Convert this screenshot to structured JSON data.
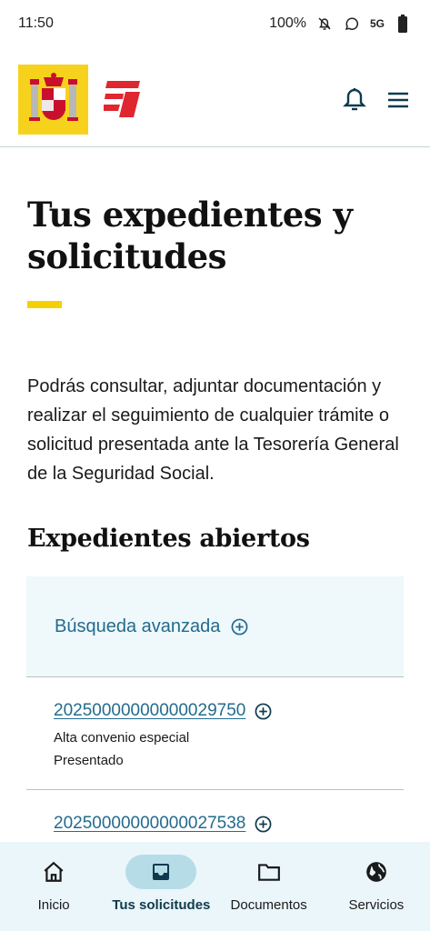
{
  "status_bar": {
    "time": "11:50",
    "battery": "100%",
    "network": "5G"
  },
  "header": {
    "notifications_icon": "bell-icon",
    "menu_icon": "hamburger-menu-icon"
  },
  "main": {
    "title": "Tus expedientes y solicitudes",
    "intro": "Podrás consultar, adjuntar documentación y realizar el seguimiento de cualquier trámite o solicitud presentada ante la Tesorería General de la Seguridad Social.",
    "section_title": "Expedientes abiertos",
    "advanced_search_label": "Búsqueda avanzada",
    "expedientes": [
      {
        "id": "20250000000000029750",
        "type": "Alta convenio especial",
        "status": "Presentado"
      },
      {
        "id": "20250000000000027538"
      }
    ]
  },
  "bottom_nav": {
    "items": [
      {
        "label": "Inicio",
        "icon": "home-icon"
      },
      {
        "label": "Tus solicitudes",
        "icon": "inbox-icon",
        "active": true
      },
      {
        "label": "Documentos",
        "icon": "folder-icon"
      },
      {
        "label": "Servicios",
        "icon": "globe-icon"
      }
    ]
  },
  "colors": {
    "accent_yellow": "#f5d000",
    "link_blue": "#236b8e",
    "nav_bg": "#eaf6fa",
    "nav_active": "#b6dce8",
    "logo_red": "#e0262f"
  }
}
